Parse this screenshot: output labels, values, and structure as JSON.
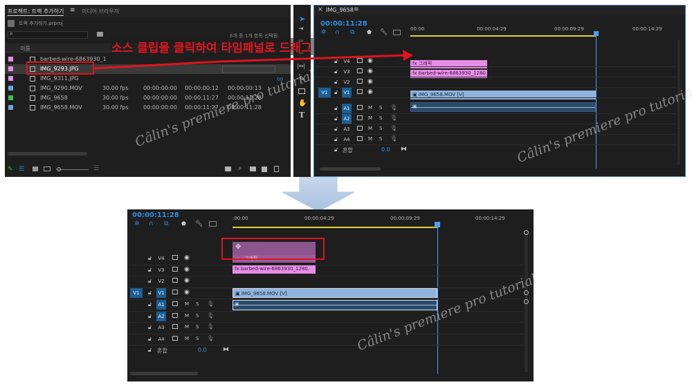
{
  "project_panel": {
    "tab_project": "프로젝트: 트랙 추가하기",
    "tab_menu": "≡",
    "tab_media_browser": "미디어 브라우저",
    "project_file": "트랙 추가하기.prproj",
    "search_placeholder": "",
    "items_selected": "6개 중 1개 항목 선택됨",
    "column_name": "이름",
    "items": [
      {
        "name": "barbed-wire-6863930_1",
        "fps": "",
        "start": "",
        "end": "",
        "dur": "",
        "color": "#e68ee6",
        "icon": "image-icon"
      },
      {
        "name": "IMG_9293.JPG",
        "fps": "",
        "start": "",
        "end": "",
        "dur": "",
        "color": "#e68ee6",
        "icon": "image-icon",
        "selected": true
      },
      {
        "name": "IMG_9311.JPG",
        "fps": "",
        "start": "",
        "end": "",
        "dur": "",
        "color": "#e68ee6",
        "icon": "image-icon"
      },
      {
        "name": "IMG_9290.MOV",
        "fps": "30.00 fps",
        "start": "00:00:00:00",
        "end": "00:00:00:12",
        "dur": "00:00:00:13",
        "color": "#6aa6e0",
        "icon": "video-icon"
      },
      {
        "name": "IMG_9658",
        "fps": "30.00 fps",
        "start": "00:00:00:00",
        "end": "00:00:11:27",
        "dur": "00:00:11:28",
        "color": "#3fbd4a",
        "icon": "sequence-icon"
      },
      {
        "name": "IMG_9658.MOV",
        "fps": "30.00 fps",
        "start": "00:00:00:00",
        "end": "00:00:11:27",
        "dur": "00:00:11:28",
        "color": "#6aa6e0",
        "icon": "video-icon"
      }
    ],
    "side_digits": [
      "00",
      "00",
      "00"
    ]
  },
  "timeline_top": {
    "tab_close": "×",
    "tab_name": "IMG_9658",
    "tab_menu": "≡",
    "timecode": "00:00:11:28",
    "ruler": [
      "00:00",
      "00:00:04:29",
      "00:00:09:29",
      "00:00:14:29"
    ],
    "video_tracks": [
      "V4",
      "V3",
      "V2",
      "V1"
    ],
    "audio_tracks": [
      "A1",
      "A2",
      "A3",
      "A4"
    ],
    "source_v1": "V1",
    "mix_label": "혼합",
    "mix_value": "0.0",
    "clips": {
      "graphic": "그래픽",
      "barbed": "barbed-wire-6863930_1280.",
      "video": "IMG_9658.MOV [V]"
    }
  },
  "timeline_bottom": {
    "timecode": "00:00:11:28",
    "ruler": [
      ":00:00",
      "00:00:04:29",
      "00:00:09:29",
      "00:00:14:29"
    ],
    "video_tracks": [
      "V4",
      "V3",
      "V2",
      "V1"
    ],
    "audio_tracks": [
      "A1",
      "A2",
      "A3",
      "A4"
    ],
    "source_v1": "V1",
    "mix_label": "혼합",
    "mix_value": "0.0",
    "clips": {
      "graphic": "그래픽",
      "barbed": "barbed-wire-6863930_1280.",
      "video": "IMG_9658.MOV [V]"
    }
  },
  "annotation": {
    "instruction": "소스 클립을 클릭하여 타임패널로 드래그",
    "color": "#e0141e"
  },
  "watermark": "Câlin's premiere pro tutorial",
  "colors": {
    "panel_bg": "#232323",
    "accent_blue": "#2e8fe6",
    "clip_pink": "#e68ee6",
    "clip_blue": "#8eb3dc",
    "playhead": "#4aa0ff",
    "work_area": "#e0d23a"
  }
}
